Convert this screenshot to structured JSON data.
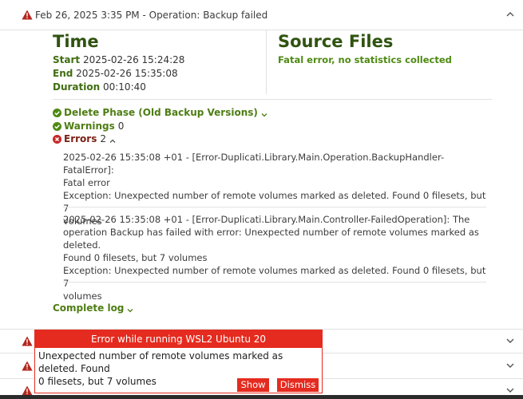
{
  "header": {
    "title": "Feb 26, 2025 3:35 PM - Operation: Backup failed"
  },
  "time": {
    "heading": "Time",
    "start_label": "Start",
    "start_value": "2025-02-26 15:24:28",
    "end_label": "End",
    "end_value": "2025-02-26 15:35:08",
    "duration_label": "Duration",
    "duration_value": "00:10:40"
  },
  "source": {
    "heading": "Source Files",
    "message": "Fatal error, no statistics collected"
  },
  "phases": {
    "delete_phase": "Delete Phase (Old Backup Versions)",
    "warnings_label": "Warnings",
    "warnings_count": "0",
    "errors_label": "Errors",
    "errors_count": "2"
  },
  "errors": [
    {
      "line1": "2025-02-26 15:35:08 +01 - [Error-Duplicati.Library.Main.Operation.BackupHandler-FatalError]:",
      "line2": "Fatal error",
      "line3": "Exception: Unexpected number of remote volumes marked as deleted. Found 0 filesets, but 7",
      "line4": "volumes"
    },
    {
      "line1": "2025-02-26 15:35:08 +01 - [Error-Duplicati.Library.Main.Controller-FailedOperation]: The",
      "line2": "operation Backup has failed with error: Unexpected number of remote volumes marked as deleted.",
      "line3": "Found 0 filesets, but 7 volumes",
      "line4": "Exception: Unexpected number of remote volumes marked as deleted. Found 0 filesets, but 7",
      "line5": "volumes"
    }
  ],
  "complete_log": "Complete log",
  "toast": {
    "title": "Error while running WSL2 Ubuntu 20",
    "line1": "Unexpected number of remote volumes marked as deleted. Found",
    "line2": "0 filesets, but 7 volumes",
    "show_label": "Show",
    "dismiss_label": "Dismiss"
  },
  "colors": {
    "accent_green": "#4e7d13",
    "heading_green": "#2f5310",
    "error_red": "#e52b1f",
    "warning_red": "#b3261e"
  },
  "icons": {
    "warning": "warning-triangle-icon",
    "check": "check-circle-icon",
    "error": "x-circle-icon",
    "chevron": "chevron-down-icon"
  }
}
